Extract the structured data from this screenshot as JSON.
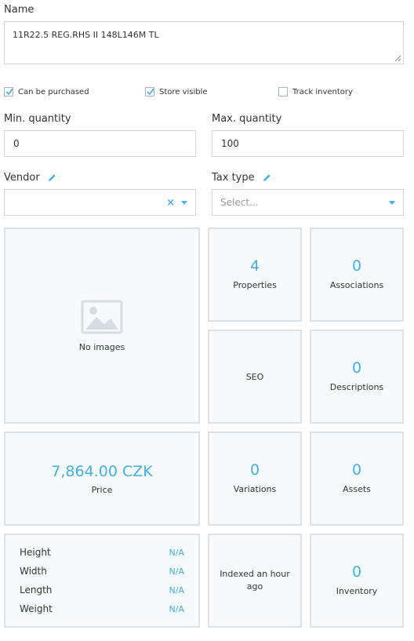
{
  "name": {
    "label": "Name",
    "value": "11R22.5 REG.RHS II 148L146M TL"
  },
  "checkboxes": [
    {
      "label": "Can be purchased",
      "checked": true
    },
    {
      "label": "Store visible",
      "checked": true
    },
    {
      "label": "Track inventory",
      "checked": false
    }
  ],
  "min_quantity": {
    "label": "Min. quantity",
    "value": "0"
  },
  "max_quantity": {
    "label": "Max. quantity",
    "value": "100"
  },
  "vendor": {
    "label": "Vendor",
    "value": ""
  },
  "tax_type": {
    "label": "Tax type",
    "placeholder": "Select..."
  },
  "tiles": {
    "images": {
      "caption": "No images"
    },
    "properties": {
      "count": "4",
      "caption": "Properties"
    },
    "associations": {
      "count": "0",
      "caption": "Associations"
    },
    "seo": {
      "caption": "SEO"
    },
    "descriptions": {
      "count": "0",
      "caption": "Descriptions"
    },
    "price": {
      "amount": "7,864.00 CZK",
      "caption": "Price"
    },
    "variations": {
      "count": "0",
      "caption": "Variations"
    },
    "assets": {
      "count": "0",
      "caption": "Assets"
    },
    "indexed": {
      "caption": "Indexed an hour ago"
    },
    "inventory": {
      "count": "0",
      "caption": "Inventory"
    }
  },
  "dimensions": [
    {
      "label": "Height",
      "value": "N/A"
    },
    {
      "label": "Width",
      "value": "N/A"
    },
    {
      "label": "Length",
      "value": "N/A"
    },
    {
      "label": "Weight",
      "value": "N/A"
    }
  ],
  "colors": {
    "accent": "#43b0e6",
    "tile_border": "#dce3e8",
    "tile_bg": "#f7f9fa"
  }
}
